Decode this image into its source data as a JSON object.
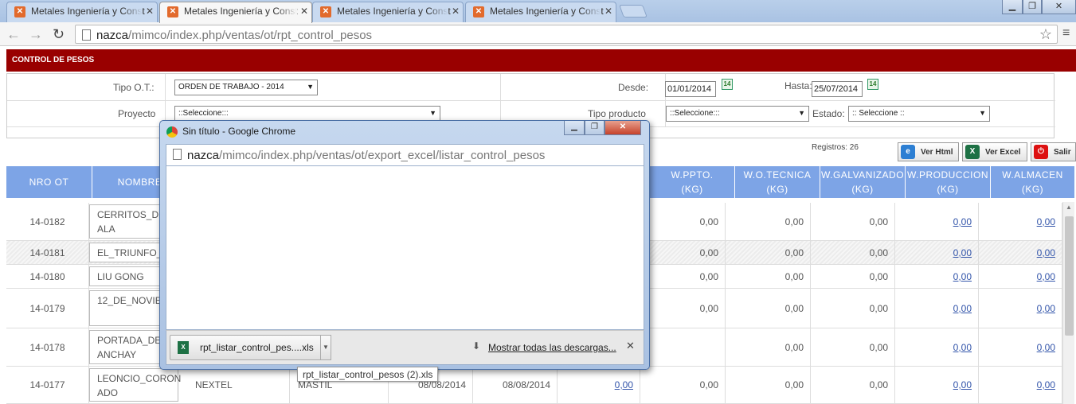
{
  "browser": {
    "tabs": [
      {
        "label": "Metales Ingeniería y Const"
      },
      {
        "label": "Metales Ingeniería y Const"
      },
      {
        "label": "Metales Ingeniería y Const"
      },
      {
        "label": "Metales Ingeniería y Const"
      }
    ],
    "url_host": "nazca",
    "url_path": "/mimco/index.php/ventas/ot/rpt_control_pesos"
  },
  "page": {
    "title": "CONTROL DE PESOS",
    "filters": {
      "tipo_ot_label": "Tipo O.T.:",
      "tipo_ot_value": "ORDEN DE TRABAJO - 2014",
      "desde_label": "Desde:",
      "desde_value": "01/01/2014",
      "hasta_label": "Hasta:",
      "hasta_value": "25/07/2014",
      "proyecto_label": "Proyecto",
      "proyecto_value": "::Seleccione:::",
      "tipo_producto_label": "Tipo producto",
      "tipo_producto_value": "::Seleccione:::",
      "estado_label": "Estado:",
      "estado_value": ":: Seleccione ::"
    },
    "registros": "Registros: 26",
    "actions": {
      "ver_html": "Ver Html",
      "ver_excel": "Ver Excel",
      "salir": "Salir"
    },
    "table": {
      "headers": {
        "nro_ot": "NRO OT",
        "nombre": "NOMBRE",
        "w_ppto": "W.PPTO.",
        "w_ppto_unit": "(KG)",
        "w_ot_tecnica": "W.O.TECNICA",
        "w_ot_tecnica_unit": "(KG)",
        "w_galvanizado": "W.GALVANIZADO",
        "w_galvanizado_unit": "(KG)",
        "w_produccion": "W.PRODUCCION",
        "w_produccion_unit": "(KG)",
        "w_almacen": "W.ALMACEN",
        "w_almacen_unit": "(KG)"
      },
      "rows": [
        {
          "nro": "14-0182",
          "nombre": "CERRITOS_DE ALA",
          "c1": "",
          "c2": "",
          "f1": "",
          "f2": "",
          "ppto_link": "",
          "ppto": "0,00",
          "tecnica": "0,00",
          "galv": "0,00",
          "prod": "0,00",
          "alm": "0,00"
        },
        {
          "nro": "14-0181",
          "nombre": "EL_TRIUNFO_",
          "c1": "",
          "c2": "",
          "f1": "",
          "f2": "",
          "ppto_link": "",
          "ppto": "0,00",
          "tecnica": "0,00",
          "galv": "0,00",
          "prod": "0,00",
          "alm": "0,00"
        },
        {
          "nro": "14-0180",
          "nombre": "LIU GONG",
          "c1": "",
          "c2": "",
          "f1": "",
          "f2": "",
          "ppto_link": "",
          "ppto": "0,00",
          "tecnica": "0,00",
          "galv": "0,00",
          "prod": "0,00",
          "alm": "0,00"
        },
        {
          "nro": "14-0179",
          "nombre": "12_DE_NOVIE RE",
          "c1": "",
          "c2": "",
          "f1": "",
          "f2": "",
          "ppto_link": "",
          "ppto": "0,00",
          "tecnica": "0,00",
          "galv": "0,00",
          "prod": "0,00",
          "alm": "0,00"
        },
        {
          "nro": "14-0178",
          "nombre": "PORTADA_DE ANCHAY",
          "c1": "",
          "c2": "",
          "f1": "",
          "f2": "",
          "ppto_link": "",
          "ppto": "",
          "tecnica": "0,00",
          "galv": "0,00",
          "prod": "0,00",
          "alm": "0,00"
        },
        {
          "nro": "14-0177",
          "nombre": "LEONCIO_CORON ADO",
          "c1": "NEXTEL",
          "c2": "MASTIL",
          "f1": "08/08/2014",
          "f2": "08/08/2014",
          "ppto_link": "0,00",
          "ppto": "0,00",
          "tecnica": "0,00",
          "galv": "0,00",
          "prod": "0,00",
          "alm": "0,00"
        }
      ]
    }
  },
  "popup": {
    "title": "Sin título - Google Chrome",
    "url_host": "nazca",
    "url_path": "/mimco/index.php/ventas/ot/export_excel/listar_control_pesos",
    "download_name": "rpt_listar_control_pes....xls",
    "show_all": "Mostrar todas las descargas...",
    "tooltip": "rpt_listar_control_pesos (2).xls"
  }
}
